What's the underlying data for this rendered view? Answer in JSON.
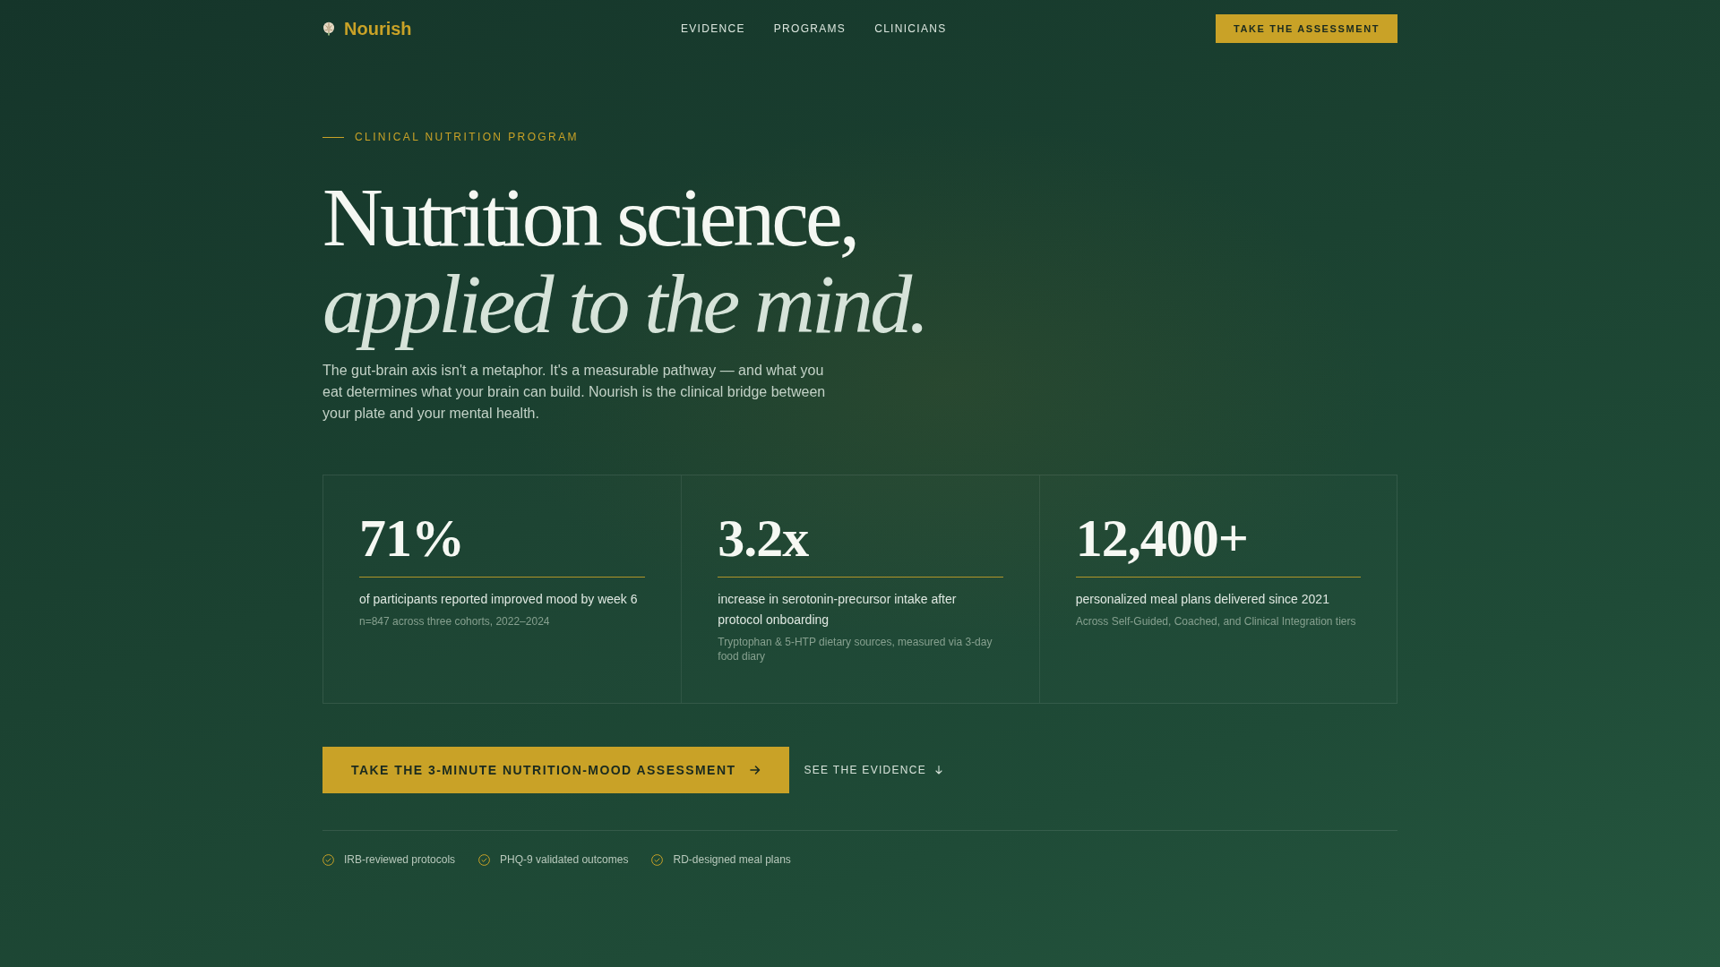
{
  "nav": {
    "logo": "Nourish",
    "links": [
      "EVIDENCE",
      "PROGRAMS",
      "CLINICIANS"
    ],
    "button": "TAKE THE ASSESSMENT"
  },
  "hero": {
    "eyebrow": "CLINICAL NUTRITION PROGRAM",
    "headline": "Nutrition science,",
    "headline_italic": "applied to the mind.",
    "lead": "The gut-brain axis isn't a metaphor. It's a measurable pathway — and what you eat determines what your brain can build. Nourish is the clinical bridge between your plate and your mental health."
  },
  "stats": [
    {
      "value": "71%",
      "label": "of participants reported improved mood by week 6",
      "note": "n=847 across three cohorts, 2022–2024"
    },
    {
      "value": "3.2x",
      "label": "increase in serotonin-precursor intake after protocol onboarding",
      "note": "Tryptophan & 5-HTP dietary sources, measured via 3-day food diary"
    },
    {
      "value": "12,400+",
      "label": "personalized meal plans delivered since 2021",
      "note": "Across Self-Guided, Coached, and Clinical Integration tiers"
    }
  ],
  "actions": {
    "primary": "TAKE THE 3-MINUTE NUTRITION-MOOD ASSESSMENT",
    "secondary": "SEE THE EVIDENCE"
  },
  "trust": [
    "IRB-reviewed protocols",
    "PHQ-9 validated outcomes",
    "RD-designed meal plans"
  ]
}
